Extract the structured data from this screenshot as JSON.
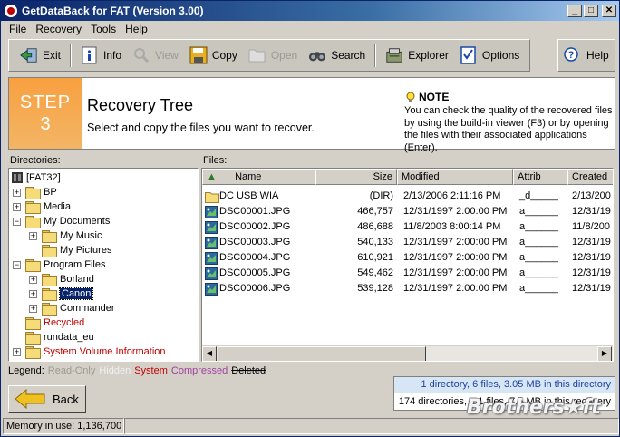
{
  "window": {
    "title": "GetDataBack for FAT (Version 3.00)"
  },
  "menu": [
    {
      "label": "File",
      "accel": "F",
      "rest": "ile"
    },
    {
      "label": "Recovery",
      "accel": "R",
      "rest": "ecovery"
    },
    {
      "label": "Tools",
      "accel": "T",
      "rest": "ools"
    },
    {
      "label": "Help",
      "accel": "H",
      "rest": "elp"
    }
  ],
  "toolbar": {
    "exit": "Exit",
    "info": "Info",
    "view": "View",
    "copy": "Copy",
    "open": "Open",
    "search": "Search",
    "explorer": "Explorer",
    "options": "Options",
    "help": "Help"
  },
  "step": {
    "word": "STEP",
    "number": "3",
    "title": "Recovery Tree",
    "subtitle": "Select and copy the files you want to recover.",
    "note_title": "NOTE",
    "note_text": "You can check the quality of the recovered files by using the build-in viewer (F3) or by opening the files with their associated applications (Enter)."
  },
  "labels": {
    "directories": "Directories:",
    "files": "Files:"
  },
  "tree": [
    {
      "label": "[FAT32]",
      "level": 0,
      "expander": "",
      "icon": "drive-icon",
      "color": "normal"
    },
    {
      "label": "BP",
      "level": 1,
      "expander": "+",
      "icon": "folder-icon",
      "color": "normal"
    },
    {
      "label": "Media",
      "level": 1,
      "expander": "+",
      "icon": "folder-icon",
      "color": "normal"
    },
    {
      "label": "My Documents",
      "level": 1,
      "expander": "−",
      "icon": "folder-icon",
      "color": "normal"
    },
    {
      "label": "My Music",
      "level": 2,
      "expander": "+",
      "icon": "folder-icon",
      "color": "normal"
    },
    {
      "label": "My Pictures",
      "level": 2,
      "expander": "",
      "icon": "folder-icon",
      "color": "normal"
    },
    {
      "label": "Program Files",
      "level": 1,
      "expander": "−",
      "icon": "folder-icon",
      "color": "normal"
    },
    {
      "label": "Borland",
      "level": 2,
      "expander": "+",
      "icon": "folder-icon",
      "color": "normal"
    },
    {
      "label": "Canon",
      "level": 2,
      "expander": "+",
      "icon": "folder-icon",
      "color": "selected"
    },
    {
      "label": "Commander",
      "level": 2,
      "expander": "+",
      "icon": "folder-icon",
      "color": "normal"
    },
    {
      "label": "Recycled",
      "level": 1,
      "expander": "",
      "icon": "folder-icon",
      "color": "red"
    },
    {
      "label": "rundata_eu",
      "level": 1,
      "expander": "",
      "icon": "folder-icon",
      "color": "normal"
    },
    {
      "label": "System Volume Information",
      "level": 1,
      "expander": "+",
      "icon": "folder-icon",
      "color": "red"
    }
  ],
  "columns": [
    "Name",
    "Size",
    "Modified",
    "Attrib",
    "Created"
  ],
  "files": [
    {
      "name": "DC USB WIA",
      "size": "(DIR)",
      "modified": "2/13/2006 2:11:16 PM",
      "attrib": "_d_____",
      "created": "2/13/200",
      "icon": "folder-icon"
    },
    {
      "name": "DSC00001.JPG",
      "size": "466,757",
      "modified": "12/31/1997 2:00:00 PM",
      "attrib": "a______",
      "created": "12/31/19",
      "icon": "image-file-icon"
    },
    {
      "name": "DSC00002.JPG",
      "size": "486,688",
      "modified": "11/8/2003 8:00:14 PM",
      "attrib": "a______",
      "created": "11/8/200",
      "icon": "image-file-icon"
    },
    {
      "name": "DSC00003.JPG",
      "size": "540,133",
      "modified": "12/31/1997 2:00:00 PM",
      "attrib": "a______",
      "created": "12/31/19",
      "icon": "image-file-icon"
    },
    {
      "name": "DSC00004.JPG",
      "size": "610,921",
      "modified": "12/31/1997 2:00:00 PM",
      "attrib": "a______",
      "created": "12/31/19",
      "icon": "image-file-icon"
    },
    {
      "name": "DSC00005.JPG",
      "size": "549,462",
      "modified": "12/31/1997 2:00:00 PM",
      "attrib": "a______",
      "created": "12/31/19",
      "icon": "image-file-icon"
    },
    {
      "name": "DSC00006.JPG",
      "size": "539,128",
      "modified": "12/31/1997 2:00:00 PM",
      "attrib": "a______",
      "created": "12/31/19",
      "icon": "image-file-icon"
    }
  ],
  "legend": {
    "label": "Legend:",
    "items": [
      {
        "text": "Read-Only",
        "color": "#9c9a94"
      },
      {
        "text": "Hidden",
        "color": "#f0f0f0"
      },
      {
        "text": "System",
        "color": "#c00000"
      },
      {
        "text": "Compressed",
        "color": "#a040a0"
      },
      {
        "text": "Deleted",
        "color": "#000000"
      }
    ]
  },
  "back_label": "Back",
  "stats": {
    "current": "1 directory, 6 files, 3.05 MB in this directory",
    "total": "174 directories, 1,1 files, 7.5 MB in this recovery"
  },
  "status": {
    "memory": "Memory in use: 1,136,700"
  },
  "watermark": "Brothers★ft"
}
